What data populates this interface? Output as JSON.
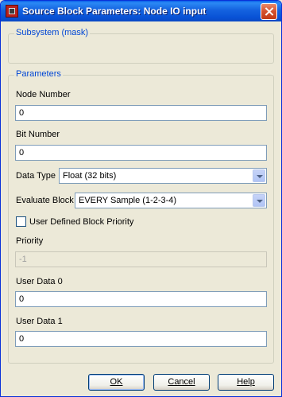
{
  "window": {
    "title": "Source Block Parameters: Node IO input"
  },
  "subsystem": {
    "legend": "Subsystem (mask)"
  },
  "parameters": {
    "legend": "Parameters",
    "node_number": {
      "label": "Node Number",
      "value": "0"
    },
    "bit_number": {
      "label": "Bit Number",
      "value": "0"
    },
    "data_type": {
      "label": "Data Type",
      "value": "Float (32 bits)"
    },
    "evaluate_block": {
      "label": "Evaluate Block",
      "value": "EVERY Sample (1-2-3-4)"
    },
    "user_priority": {
      "label": "User Defined Block Priority",
      "checked": false
    },
    "priority": {
      "label": "Priority",
      "value": "-1"
    },
    "user_data_0": {
      "label": "User Data 0",
      "value": "0"
    },
    "user_data_1": {
      "label": "User Data 1",
      "value": "0"
    }
  },
  "buttons": {
    "ok": "OK",
    "cancel": "Cancel",
    "help": "Help"
  }
}
